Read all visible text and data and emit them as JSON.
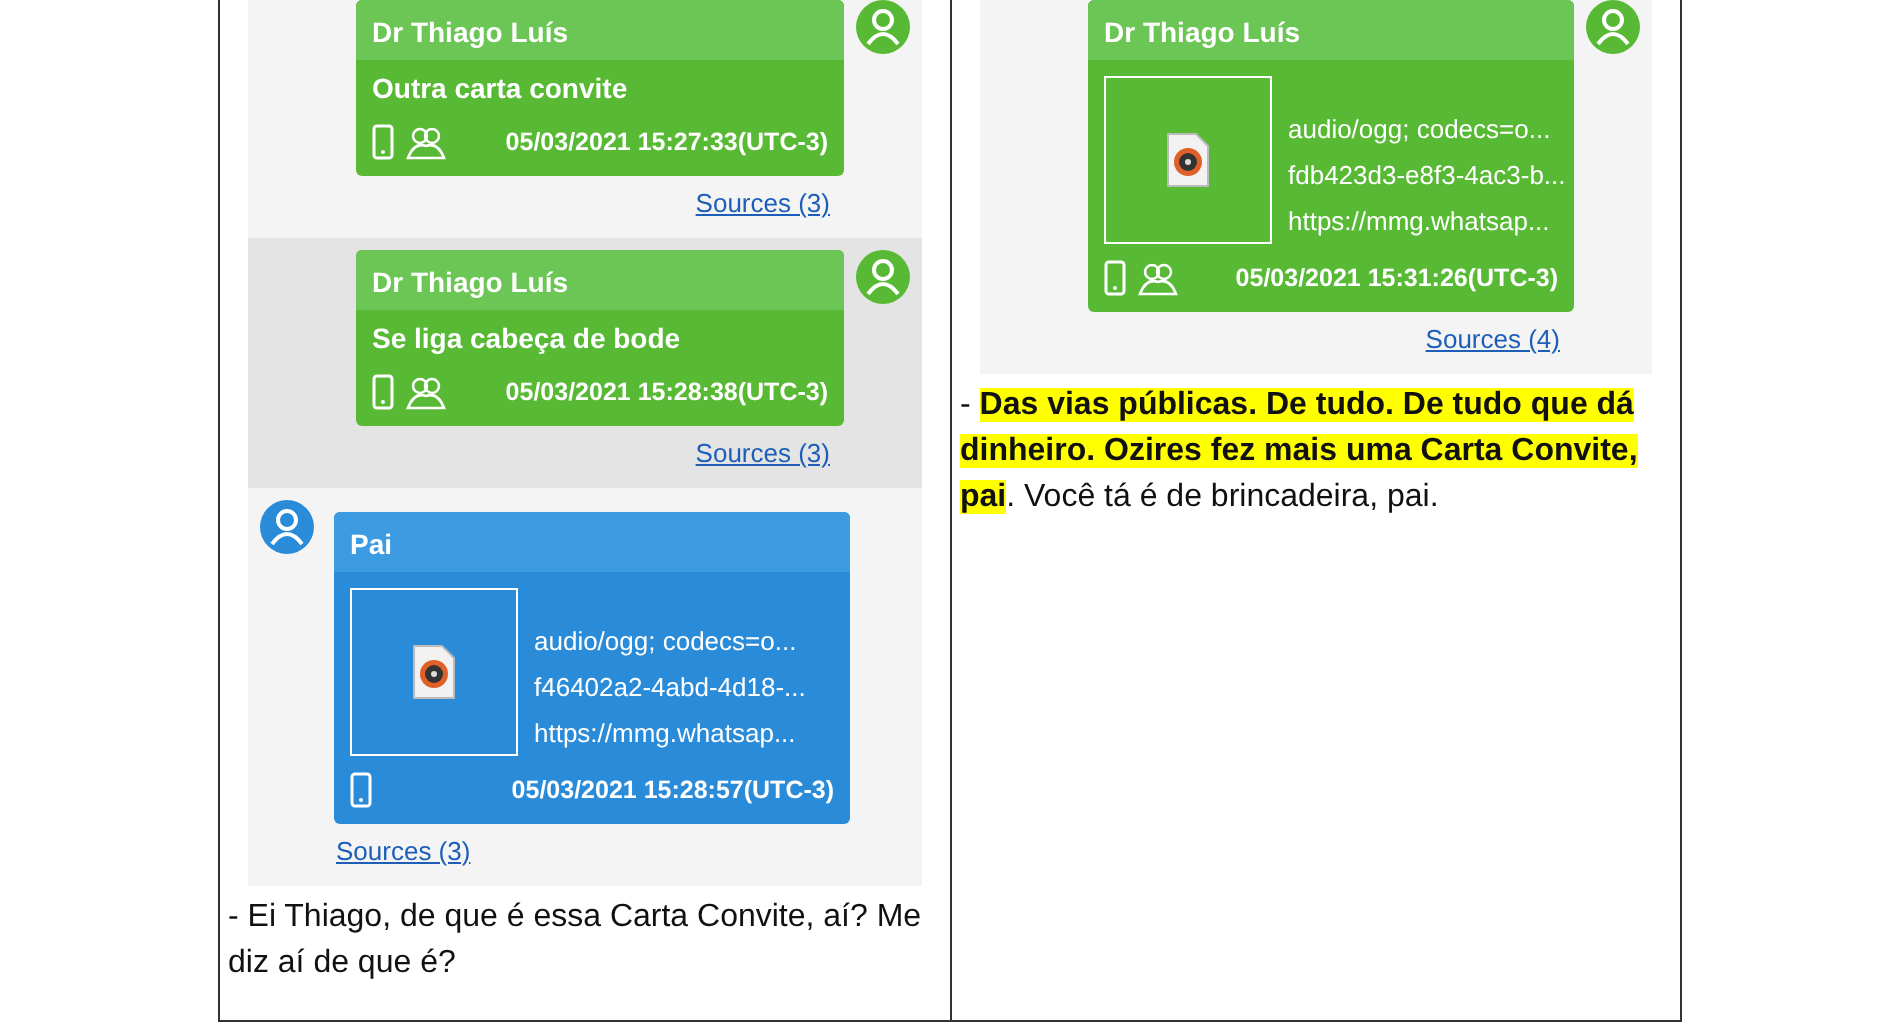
{
  "columns": [
    {
      "messages": [
        {
          "sender": "Dr Thiago Luís",
          "kind": "outgoing",
          "shaded": false,
          "text": "Outra carta convite",
          "group": true,
          "timestamp": "05/03/2021 15:27:33(UTC-3)",
          "sources": "Sources (3)"
        },
        {
          "sender": "Dr Thiago Luís",
          "kind": "outgoing",
          "shaded": true,
          "text": "Se liga cabeça de bode",
          "group": true,
          "timestamp": "05/03/2021 15:28:38(UTC-3)",
          "sources": "Sources (3)"
        },
        {
          "sender": "Pai",
          "kind": "incoming",
          "shaded": false,
          "lines": [
            "audio/ogg; codecs=o...",
            "f46402a2-4abd-4d18-...",
            "https://mmg.whatsap..."
          ],
          "group": false,
          "timestamp": "05/03/2021 15:28:57(UTC-3)",
          "sources": "Sources (3)"
        }
      ],
      "caption": [
        {
          "text": "- Ei Thiago, de que é essa Carta Convite, aí? Me diz aí de que é?",
          "highlighted": false
        }
      ]
    },
    {
      "messages": [
        {
          "sender": "Dr Thiago Luís",
          "kind": "outgoing",
          "shaded": false,
          "lines": [
            "audio/ogg; codecs=o...",
            "fdb423d3-e8f3-4ac3-b...",
            "https://mmg.whatsap..."
          ],
          "group": true,
          "timestamp": "05/03/2021 15:31:26(UTC-3)",
          "sources": "Sources (4)"
        }
      ],
      "caption": [
        {
          "text": "- ",
          "highlighted": false
        },
        {
          "text": "Das vias públicas. De tudo. De tudo que dá dinheiro. Ozires fez mais uma Carta Convite, pai",
          "highlighted": true
        },
        {
          "text": ". Você tá é de brincadeira, pai.",
          "highlighted": false
        }
      ]
    }
  ]
}
